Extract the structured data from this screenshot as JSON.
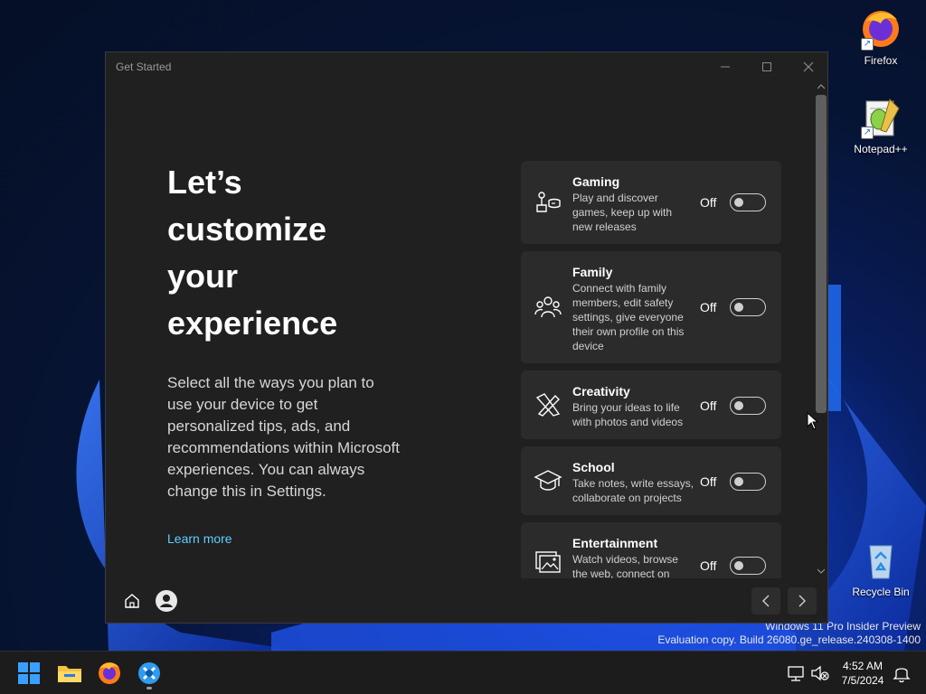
{
  "desktop": {
    "icons": [
      {
        "label": "Firefox"
      },
      {
        "label": "Notepad++"
      },
      {
        "label": "Recycle Bin"
      }
    ],
    "watermark": {
      "line1": "Windows 11 Pro Insider Preview",
      "line2": "Evaluation copy. Build 26080.ge_release.240308-1400"
    }
  },
  "window": {
    "title": "Get Started",
    "heading": "Let’s customize your experience",
    "description": "Select all the ways you plan to use your device to get personalized tips, ads, and recommendations within Microsoft experiences. You can always change this in Settings.",
    "learn_more": "Learn more",
    "cards": [
      {
        "title": "Gaming",
        "desc": "Play and discover games, keep up with new releases",
        "state": "Off",
        "icon": "gamepad-icon"
      },
      {
        "title": "Family",
        "desc": "Connect with family members, edit safety settings, give everyone their own profile on this device",
        "state": "Off",
        "icon": "family-icon"
      },
      {
        "title": "Creativity",
        "desc": "Bring your ideas to life with photos and videos",
        "state": "Off",
        "icon": "brush-icon"
      },
      {
        "title": "School",
        "desc": "Take notes, write essays, collaborate on projects",
        "state": "Off",
        "icon": "graduation-cap-icon"
      },
      {
        "title": "Entertainment",
        "desc": "Watch videos, browse the web, connect on",
        "state": "Off",
        "icon": "photo-icon"
      }
    ]
  },
  "taskbar": {
    "time": "4:52 AM",
    "date": "7/5/2024"
  },
  "colors": {
    "accent": "#60cdff",
    "window_bg": "#202020",
    "card_bg": "#2b2b2b",
    "taskbar_bg": "#1c1c1c"
  }
}
